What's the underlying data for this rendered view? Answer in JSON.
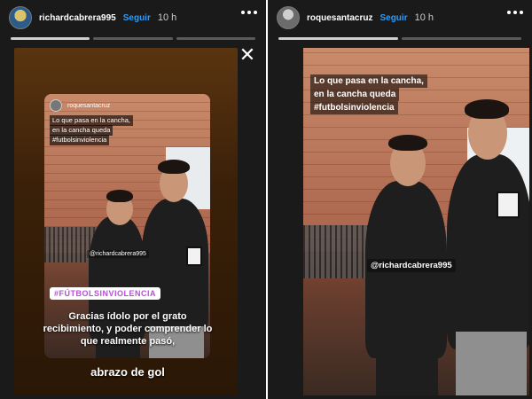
{
  "left": {
    "header": {
      "username": "richardcabrera995",
      "follow": "Seguir",
      "time": "10 h"
    },
    "progress_segments": 3,
    "inner": {
      "username": "roquesantacruz",
      "caption_lines": [
        "Lo que pasa en la cancha,",
        "en la cancha queda",
        "#futbolsinviolencia"
      ],
      "mention": "@richardcabrera995"
    },
    "hashtag": "#FÚTBOLSINVIOLENCIA",
    "thanks_text": "Gracias ídolo por el grato recibimiento, y poder comprender lo que realmente pasó,",
    "abrazo": "abrazo de gol"
  },
  "right": {
    "header": {
      "username": "roquesantacruz",
      "follow": "Seguir",
      "time": "10 h"
    },
    "progress_segments": 2,
    "caption_lines": [
      "Lo que pasa en la cancha,",
      "en la cancha queda",
      "#futbolsinviolencia"
    ],
    "mention": "@richardcabrera995"
  },
  "colors": {
    "follow": "#2f9bf7",
    "background": "#1a1a1a"
  }
}
